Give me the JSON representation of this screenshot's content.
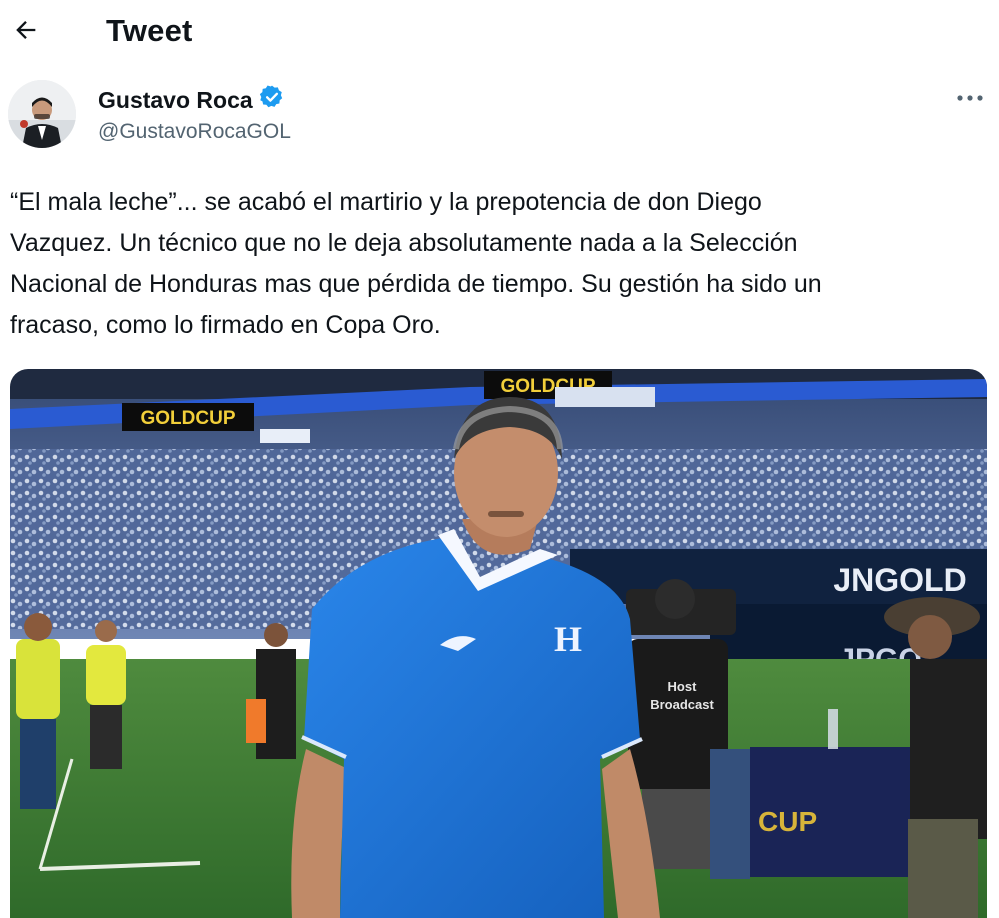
{
  "header": {
    "title": "Tweet",
    "back_icon": "arrow-left-icon"
  },
  "author": {
    "name": "Gustavo Roca",
    "handle": "@GustavoRocaGOL",
    "verified_icon": "verified-badge-icon",
    "verified_color": "#1d9bf0"
  },
  "more_icon": "more-horizontal-icon",
  "tweet": {
    "lines": [
      "“El mala leche”... se acabó el martirio y la prepotencia de don Diego",
      "Vazquez. Un técnico que no le deja absolutamente nada a la Selección",
      "Nacional de Honduras mas que pérdida de tiempo. Su gestión ha sido un",
      "fracaso, como lo firmado en Copa Oro."
    ]
  },
  "media": {
    "banner_left": "GOLDCUP",
    "banner_center": "GOLDCUP",
    "board_text": "JNGOLD",
    "board_text_2": "JPGO",
    "camera_vest_line1": "Host",
    "camera_vest_line2": "Broadcast",
    "table_text": "CUP",
    "crest_letter": "H"
  },
  "colors": {
    "text_primary": "#0f1419",
    "text_secondary": "#536471",
    "jersey_blue": "#1e73d6",
    "pitch_green": "#3f7a35",
    "banner_gold": "#f2cf3a"
  }
}
